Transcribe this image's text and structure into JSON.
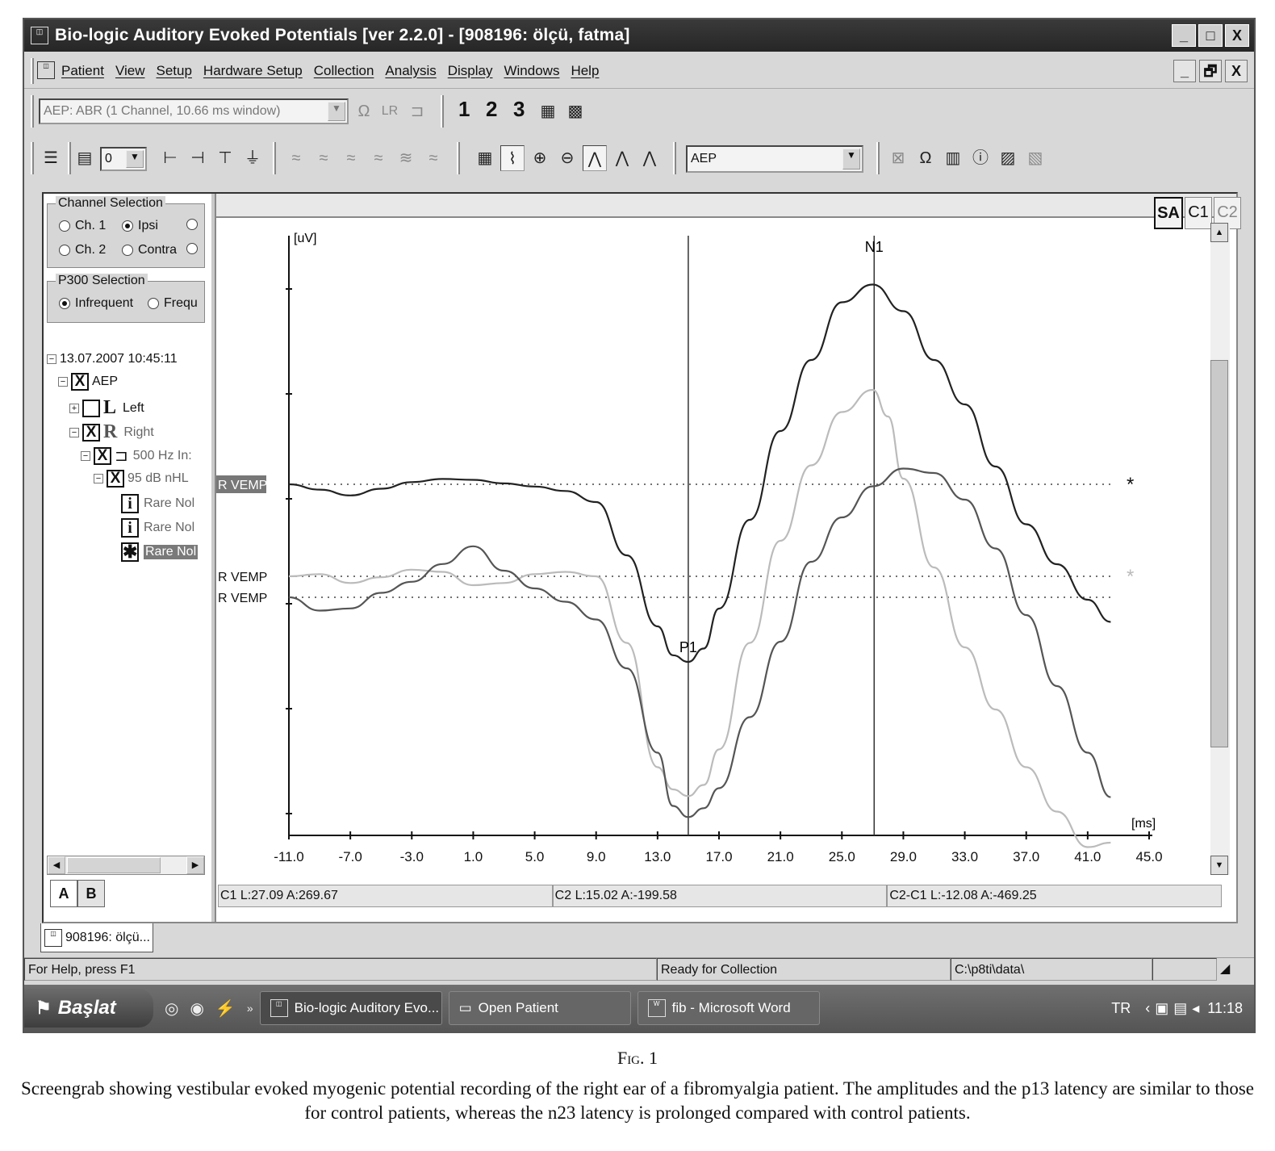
{
  "window": {
    "title": "Bio-logic Auditory Evoked Potentials [ver 2.2.0] - [908196: ölçü, fatma]",
    "controls": [
      "_",
      "□",
      "X"
    ]
  },
  "menu": {
    "items": [
      "Patient",
      "View",
      "Setup",
      "Hardware Setup",
      "Collection",
      "Analysis",
      "Display",
      "Windows",
      "Help"
    ],
    "mdi_controls": [
      "_",
      "🗗",
      "X"
    ]
  },
  "toolbar1": {
    "protocol_combo": "AEP: ABR (1 Channel, 10.66 ms window)",
    "numbers": [
      "1",
      "2",
      "3"
    ]
  },
  "toolbar2": {
    "spin_value": "0",
    "mode_combo": "AEP"
  },
  "left_panel": {
    "channel_group": {
      "title": "Channel Selection",
      "options": [
        {
          "label": "Ch. 1",
          "checked": false
        },
        {
          "label": "Ipsi",
          "checked": true
        },
        {
          "label": "Ch. 2",
          "checked": false
        },
        {
          "label": "Contra",
          "checked": false
        }
      ]
    },
    "p300_group": {
      "title": "P300 Selection",
      "options": [
        {
          "label": "Infrequent",
          "checked": true
        },
        {
          "label": "Frequ",
          "checked": false
        }
      ]
    },
    "tree": {
      "session": "13.07.2007 10:45:11",
      "test": "AEP",
      "left_ear": {
        "letter": "L",
        "label": "Left"
      },
      "right_ear": {
        "letter": "R",
        "label": "Right"
      },
      "stimulus": "500 Hz In:",
      "level": "95 dB nHL",
      "records": [
        "Rare Nol",
        "Rare Nol",
        "Rare Nol"
      ]
    },
    "tabs": [
      "A",
      "B"
    ]
  },
  "plot_panel": {
    "view_buttons": [
      "SA",
      "C1",
      "C2"
    ],
    "readouts": [
      "C1 L:27.09 A:269.67",
      "C2 L:15.02 A:-199.58",
      "C2-C1 L:-12.08 A:-469.25"
    ]
  },
  "chart_data": {
    "type": "line",
    "xlabel": "[ms]",
    "ylabel": "[uV]",
    "xlim": [
      -11.0,
      45.0
    ],
    "xticks": [
      "-11.0",
      "-7.0",
      "-3.0",
      "1.0",
      "5.0",
      "9.0",
      "13.0",
      "17.0",
      "21.0",
      "25.0",
      "29.0",
      "33.0",
      "37.0",
      "41.0",
      "45.0"
    ],
    "grid": false,
    "trace_label": "R VEMP",
    "markers": [
      {
        "label": "P1",
        "x": 15.0
      },
      {
        "label": "N1",
        "x": 27.1
      }
    ],
    "star_symbol": "*",
    "series": [
      {
        "color": "#222222",
        "x": [
          -11,
          -9,
          -7,
          -5,
          -3,
          -1,
          1,
          3,
          5,
          7,
          9,
          11,
          13,
          14,
          15,
          16,
          17,
          19,
          21,
          23,
          25,
          27,
          29,
          31,
          33,
          35,
          37,
          39,
          41,
          42.5
        ],
        "y": [
          0.0,
          -0.12,
          -0.25,
          -0.1,
          0.05,
          0.12,
          0.1,
          0.02,
          -0.05,
          -0.15,
          -0.4,
          -1.6,
          -3.2,
          -3.85,
          -4.0,
          -3.7,
          -2.8,
          -0.8,
          1.2,
          2.8,
          4.1,
          4.5,
          3.9,
          2.8,
          1.8,
          0.4,
          -0.9,
          -1.8,
          -2.6,
          -3.1
        ]
      },
      {
        "color": "#bbbbbb",
        "x": [
          -11,
          -9,
          -7,
          -5,
          -3,
          -1,
          1,
          3,
          5,
          7,
          9,
          11,
          13,
          14,
          15,
          16,
          17,
          19,
          21,
          23,
          25,
          27,
          28,
          29,
          31,
          33,
          35,
          37,
          39,
          41,
          42.5
        ],
        "y": [
          0.0,
          0.05,
          -0.15,
          -0.02,
          0.15,
          0.1,
          -0.2,
          -0.15,
          0.05,
          0.1,
          0.0,
          -1.5,
          -4.3,
          -4.8,
          -4.95,
          -4.7,
          -3.9,
          -1.5,
          0.8,
          2.5,
          3.7,
          4.2,
          3.6,
          2.2,
          0.2,
          -1.6,
          -3.0,
          -4.3,
          -5.3,
          -6.1,
          -6.0
        ]
      },
      {
        "color": "#555555",
        "x": [
          -11,
          -9,
          -7,
          -5,
          -3,
          -1,
          1,
          3,
          5,
          7,
          9,
          11,
          13,
          14,
          15,
          16,
          17,
          19,
          21,
          23,
          25,
          27,
          29,
          31,
          33,
          35,
          37,
          39,
          41,
          42.5
        ],
        "y": [
          0.0,
          -0.3,
          -0.25,
          0.1,
          0.35,
          0.75,
          1.15,
          0.6,
          0.2,
          -0.1,
          -0.5,
          -1.6,
          -3.5,
          -4.7,
          -4.95,
          -4.75,
          -4.3,
          -2.7,
          -1.0,
          0.8,
          1.8,
          2.5,
          2.9,
          2.8,
          2.2,
          1.1,
          -0.4,
          -2.0,
          -3.5,
          -4.5
        ]
      }
    ]
  },
  "document_tab": "908196: ölçü...",
  "status_bar": {
    "help": "For Help, press F1",
    "state": "Ready for Collection",
    "path": "C:\\p8ti\\data\\"
  },
  "taskbar": {
    "start": "Başlat",
    "buttons": [
      "Bio-logic Auditory Evo...",
      "Open Patient",
      "fib - Microsoft Word"
    ],
    "language": "TR",
    "clock": "11:18"
  },
  "caption": {
    "figure": "Fig. 1",
    "text": "Screengrab showing vestibular evoked myogenic potential recording of the right ear of a fibromyalgia patient. The amplitudes and the p13 latency are similar to those for control patients, whereas the n23 latency is prolonged compared with control patients."
  }
}
